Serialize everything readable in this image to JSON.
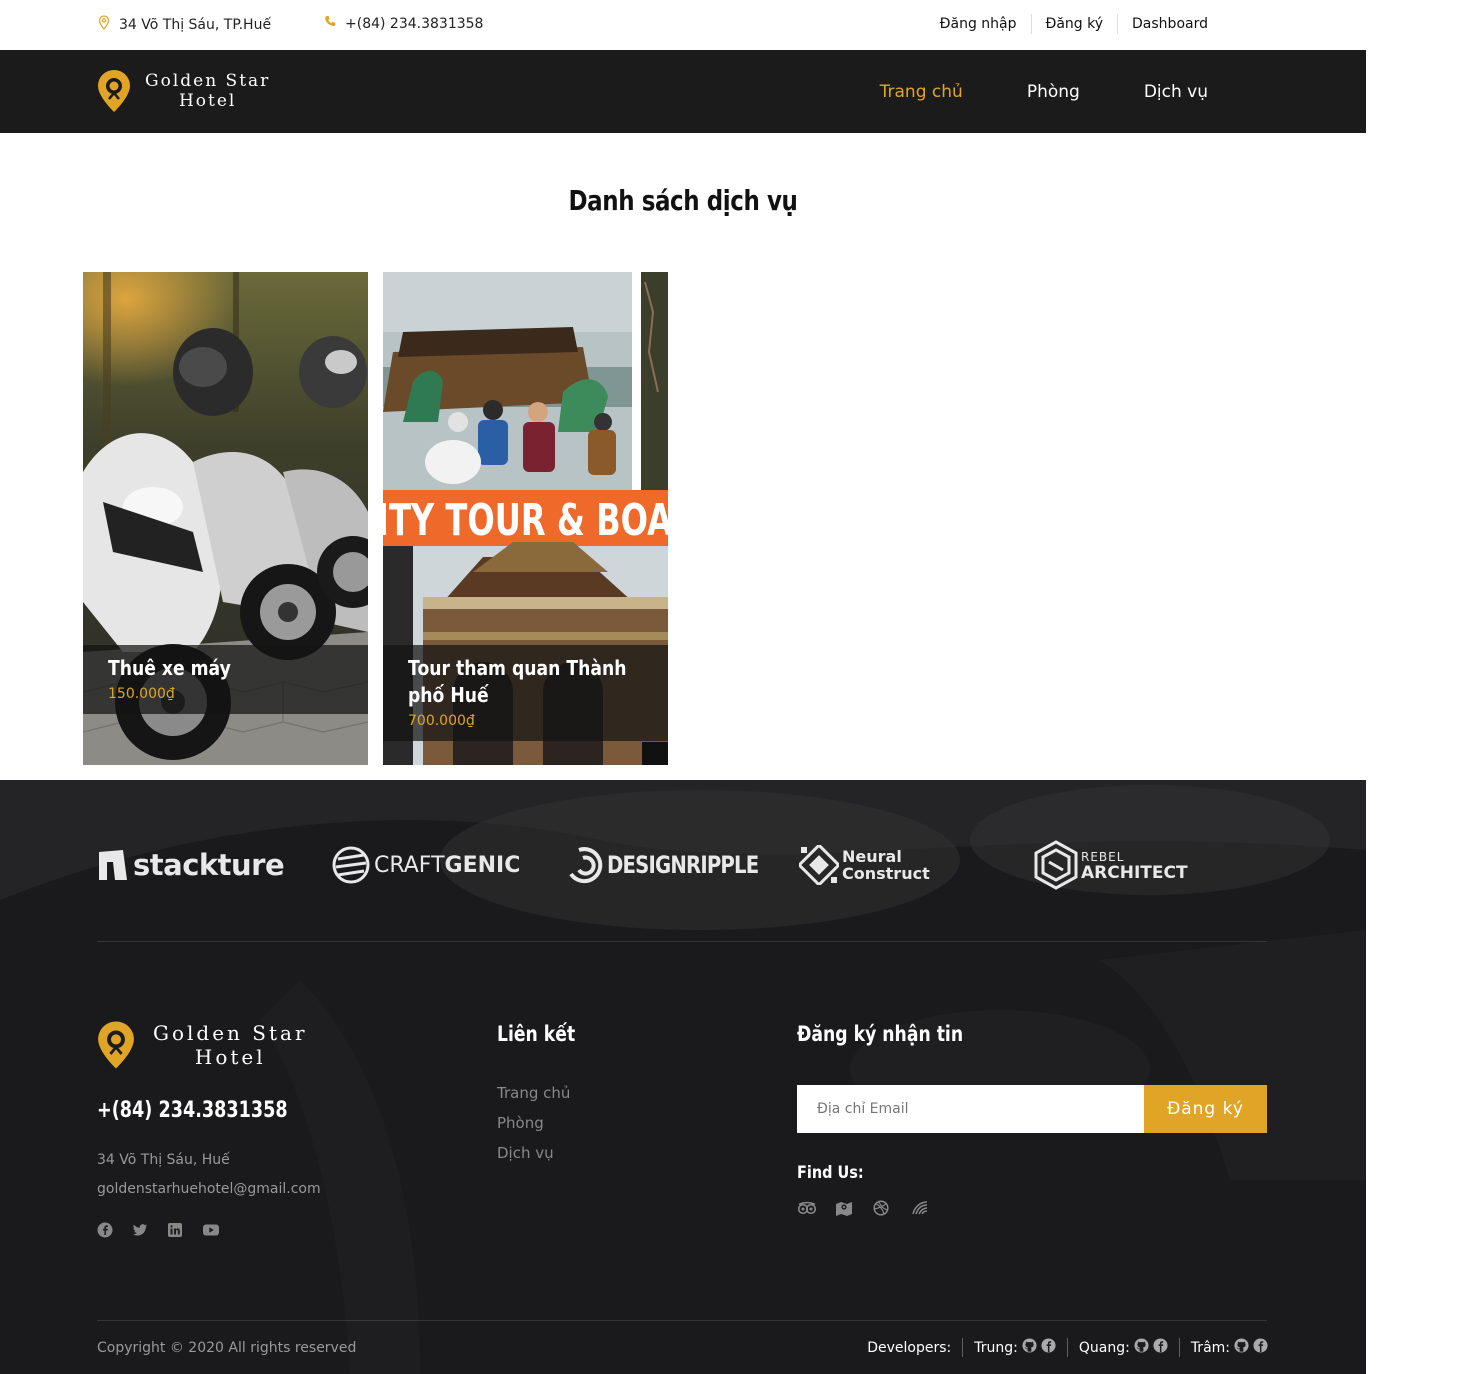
{
  "topbar": {
    "address": "34 Võ Thị Sáu, TP.Huế",
    "phone": "+(84) 234.3831358",
    "links": [
      "Đăng nhập",
      "Đăng ký",
      "Dashboard"
    ]
  },
  "brand": {
    "line1": "Golden Star",
    "line2": "Hotel",
    "accent": "#e0a526"
  },
  "nav": {
    "items": [
      "Trang chủ",
      "Phòng",
      "Dịch vụ"
    ],
    "active": "Trang chủ"
  },
  "page": {
    "title": "Danh sách dịch vụ"
  },
  "services": [
    {
      "name": "Thuê xe máy",
      "price": "150.000₫"
    },
    {
      "name": "Tour tham quan Thành phố Huế",
      "price": "700.000₫",
      "banner_text": "ITY TOUR & BOA"
    }
  ],
  "partners": [
    {
      "a": "stackture",
      "b": ""
    },
    {
      "a": "CRAFT",
      "b": "GENIC"
    },
    {
      "a": "DESIGNRIPPLE",
      "b": ""
    },
    {
      "a": "Neural",
      "b": "Construct"
    },
    {
      "a": "REBEL",
      "b": "ARCHITECT"
    }
  ],
  "footer": {
    "phone": "+(84) 234.3831358",
    "address": "34 Võ Thị Sáu, Huế",
    "email": "goldenstarhuehotel@gmail.com",
    "social_icons": [
      "facebook-icon",
      "twitter-icon",
      "linkedin-icon",
      "youtube-icon"
    ],
    "links_heading": "Liên kết",
    "links": [
      "Trang chủ",
      "Phòng",
      "Dịch vụ"
    ],
    "newsletter_heading": "Đăng ký nhận tin",
    "email_placeholder": "Địa chỉ Email",
    "subscribe_label": "Đăng ký",
    "find_us": "Find Us:",
    "find_icons": [
      "tripadvisor-icon",
      "map-icon",
      "dribbble-icon",
      "stripe-icon"
    ],
    "copyright": "Copyright © 2020 All rights reserved",
    "developers_label": "Developers:",
    "developers": [
      "Trung:",
      "Quang:",
      "Trâm:"
    ]
  }
}
